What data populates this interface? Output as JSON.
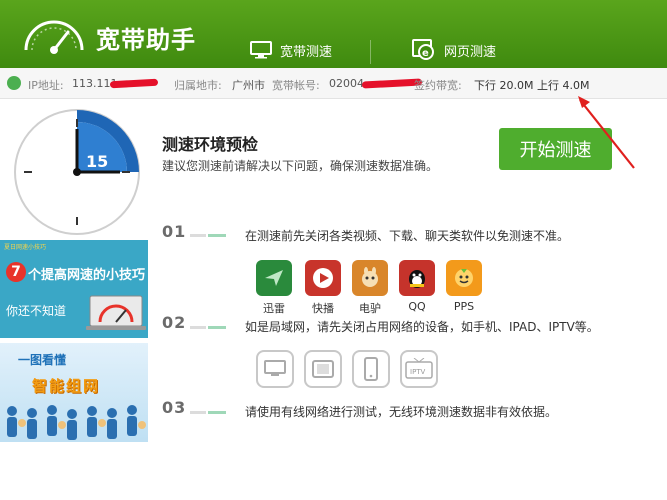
{
  "header": {
    "title": "宽带助手",
    "tabs": [
      {
        "label": "宽带测速"
      },
      {
        "label": "网页测速"
      }
    ]
  },
  "infobar": {
    "ip_label": "IP地址:",
    "ip_value": "113.111.",
    "location_label": "归属地市:",
    "location_value": "广州市",
    "account_label": "宽带帐号:",
    "account_value": "02004",
    "bandwidth_label": "签约带宽:",
    "bandwidth_value": "下行 20.0M 上行 4.0M"
  },
  "test": {
    "title": "测速环境预检",
    "desc": "建议您测速前请解决以下问题，确保测速数据准确。",
    "start_button": "开始测速",
    "clock_value": "15"
  },
  "ads": {
    "tip_topline": "夏日网速小技巧",
    "tip_number": "7",
    "tip_title": "个提高网速的小技巧",
    "tip_sub": "你还不知道",
    "network_title": "一图看懂",
    "network_sub": "智能组网"
  },
  "steps": [
    {
      "no": "01",
      "text": "在测速前先关闭各类视频、下载、聊天类软件以免测速不准。"
    },
    {
      "no": "02",
      "text": "如是局域网，请先关闭占用网络的设备，如手机、IPAD、IPTV等。"
    },
    {
      "no": "03",
      "text": "请使用有线网络进行测试，无线环境测速数据非有效依据。"
    }
  ],
  "apps": [
    {
      "label": "迅雷",
      "icon": "xunlei-bird-icon",
      "color": "#2a8a3c"
    },
    {
      "label": "快播",
      "icon": "kuaibo-play-icon",
      "color": "#c8342b"
    },
    {
      "label": "电驴",
      "icon": "emule-donkey-icon",
      "color": "#d9862a"
    },
    {
      "label": "QQ",
      "icon": "qq-penguin-icon",
      "color": "#1b1b1b"
    },
    {
      "label": "PPS",
      "icon": "pps-icon",
      "color": "#f39a1b"
    }
  ],
  "devices": [
    {
      "icon": "monitor-icon"
    },
    {
      "icon": "tablet-icon"
    },
    {
      "icon": "phone-icon"
    },
    {
      "icon": "iptv-icon",
      "text": "IPTV"
    }
  ],
  "colors": {
    "header_green": "#4a9a16",
    "button_green": "#4fad2e",
    "clock_blue": "#1f66b5",
    "step_green": "#9fd8b8"
  }
}
